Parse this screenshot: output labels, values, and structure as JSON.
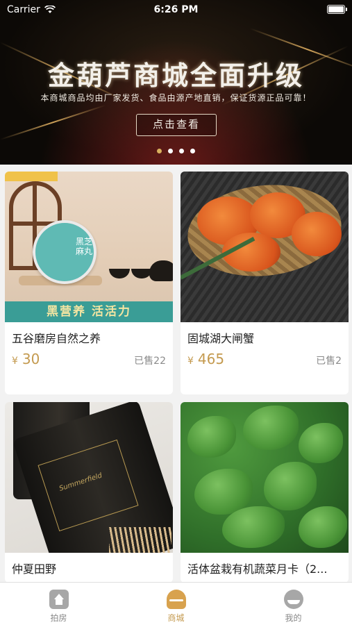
{
  "status_bar": {
    "carrier": "Carrier",
    "time": "6:26 PM",
    "wifi_icon": "wifi-icon",
    "battery_icon": "battery-icon"
  },
  "banner": {
    "title": "金葫芦商城全面升级",
    "subtitle": "本商城商品均由厂家发货、食品由源产地直销，保证货源正品可靠！",
    "cta_label": "点击查看",
    "page_count": 4,
    "active_index": 0
  },
  "products": [
    {
      "name": "五谷磨房自然之养",
      "currency": "¥",
      "price": "30",
      "sold": "已售22",
      "image_strip_text": "黑营养 活活力",
      "jar_text": "黑芝麻丸"
    },
    {
      "name": "固城湖大闸蟹",
      "currency": "¥",
      "price": "465",
      "sold": "已售2"
    },
    {
      "name": "仲夏田野",
      "label_text": "Summerfield"
    },
    {
      "name": "活体盆栽有机蔬菜月卡（2..."
    }
  ],
  "tabbar": {
    "items": [
      {
        "label": "拍房",
        "icon": "house-icon",
        "active": false
      },
      {
        "label": "商城",
        "icon": "shop-icon",
        "active": true
      },
      {
        "label": "我的",
        "icon": "profile-icon",
        "active": false
      }
    ]
  },
  "colors": {
    "accent": "#c49a4f",
    "tab_active": "#d8a24e",
    "text": "#222222",
    "muted": "#8a8a8a"
  }
}
